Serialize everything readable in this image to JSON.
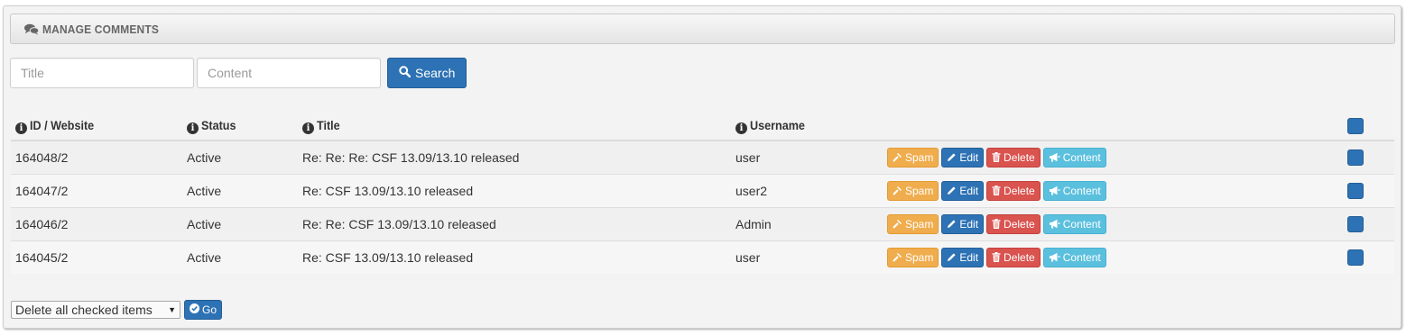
{
  "panel": {
    "title": "MANAGE COMMENTS",
    "icon": "comments-icon"
  },
  "search": {
    "title_placeholder": "Title",
    "title_value": "",
    "content_placeholder": "Content",
    "content_value": "",
    "button_label": "Search"
  },
  "table": {
    "columns": [
      "ID / Website",
      "Status",
      "Title",
      "Username"
    ],
    "rows": [
      {
        "id": "164048/2",
        "status": "Active",
        "title": "Re: Re: Re: CSF 13.09/13.10 released",
        "username": "user"
      },
      {
        "id": "164047/2",
        "status": "Active",
        "title": "Re: CSF 13.09/13.10 released",
        "username": "user2"
      },
      {
        "id": "164046/2",
        "status": "Active",
        "title": "Re: Re: CSF 13.09/13.10 released",
        "username": "Admin"
      },
      {
        "id": "164045/2",
        "status": "Active",
        "title": "Re: CSF 13.09/13.10 released",
        "username": "user"
      }
    ],
    "actions": {
      "spam": "Spam",
      "edit": "Edit",
      "delete": "Delete",
      "content": "Content"
    }
  },
  "bulk": {
    "selected_option": "Delete all checked items",
    "go_label": "Go"
  },
  "colors": {
    "primary": "#2d72b4",
    "warning": "#f0ad4e",
    "danger": "#d9534f",
    "info": "#5bc0de"
  }
}
